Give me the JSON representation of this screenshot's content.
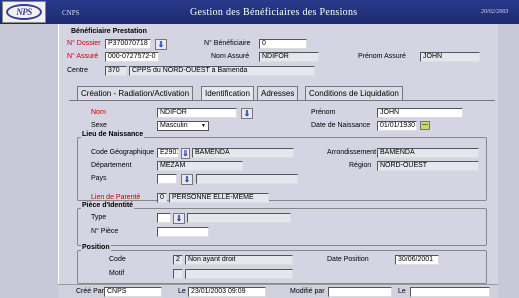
{
  "header": {
    "logo_text": "NPS",
    "org": "CNPS",
    "title": "Gestion des Bénéficiaires des Pensions",
    "date": "20/02/2003"
  },
  "beneficiary": {
    "section_title": "Bénéficiaire Prestation",
    "dossier_label": "N° Dossier",
    "dossier_value": "P370070718",
    "num_benef_label": "N° Bénéficiaire",
    "num_benef_value": "0",
    "assure_label": "N° Assuré",
    "assure_value": "000-0727572-0",
    "nom_assure_label": "Nom Assuré",
    "nom_assure_value": "NDIFOR",
    "prenom_assure_label": "Prénom Assuré",
    "prenom_assure_value": "JOHN",
    "centre_label": "Centre",
    "centre_code": "370",
    "centre_name": "CPPS du NORD-OUEST à Bamenda"
  },
  "tabs": [
    {
      "label": "Création - Radiation/Activation",
      "active": false
    },
    {
      "label": "Identification",
      "active": true
    },
    {
      "label": "Adresses",
      "active": false
    },
    {
      "label": "Conditions de Liquidation",
      "active": false
    }
  ],
  "identification": {
    "nom_label": "Nom",
    "nom_value": "NDIFOR",
    "prenom_label": "Prénom",
    "prenom_value": "JOHN",
    "sexe_label": "Sexe",
    "sexe_value": "Masculin",
    "date_naissance_label": "Date de Naissance",
    "date_naissance_value": "01/01/1930"
  },
  "lieu_naissance": {
    "title": "Lieu de Naissance",
    "code_geo_label": "Code Géographique",
    "code_geo_value": "E2901",
    "code_geo_name": "BAMENDA",
    "arrondissement_label": "Arrondissement",
    "arrondissement_value": "BAMENDA",
    "departement_label": "Département",
    "departement_value": "MEZAM",
    "region_label": "Région",
    "region_value": "NORD-OUEST",
    "pays_label": "Pays",
    "pays_value": ""
  },
  "parente": {
    "label": "Lien de Parenté",
    "code": "0",
    "value": "PERSONNE ELLE-MÊME"
  },
  "piece": {
    "title": "Pièce d'Identité",
    "type_label": "Type",
    "type_value": "",
    "numero_label": "N° Pièce",
    "numero_value": ""
  },
  "position": {
    "title": "Position",
    "code_label": "Code",
    "code_num": "2",
    "code_value": "Non ayant droit",
    "date_label": "Date Position",
    "date_value": "30/06/2001",
    "motif_label": "Motif",
    "motif_value": ""
  },
  "footer": {
    "cree_par_label": "Créé Par",
    "cree_par_value": "CNPS",
    "le_label": "Le",
    "le_value": "23/01/2003 09:09",
    "modifie_par_label": "Modifié par",
    "modifie_par_value": "",
    "le2_label": "Le",
    "le2_value": ""
  },
  "icons": {
    "lookup": "down-arrow-icon",
    "calendar": "calendar-icon",
    "dropdown": "chevron-down-icon"
  }
}
